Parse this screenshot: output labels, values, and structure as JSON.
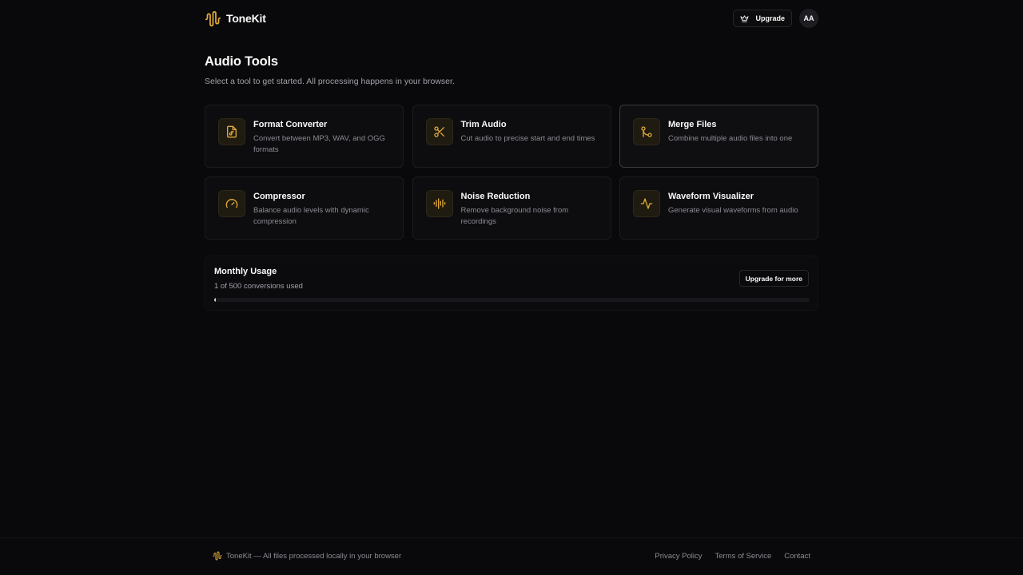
{
  "header": {
    "brand_name": "ToneKit",
    "upgrade_label": "Upgrade",
    "avatar_initials": "AA"
  },
  "page": {
    "title": "Audio Tools",
    "subtitle": "Select a tool to get started. All processing happens in your browser."
  },
  "tools": [
    {
      "name": "Format Converter",
      "description": "Convert between MP3, WAV, and OGG formats",
      "icon": "file-audio-icon"
    },
    {
      "name": "Trim Audio",
      "description": "Cut audio to precise start and end times",
      "icon": "scissors-icon"
    },
    {
      "name": "Merge Files",
      "description": "Combine multiple audio files into one",
      "icon": "git-merge-icon"
    },
    {
      "name": "Compressor",
      "description": "Balance audio levels with dynamic compression",
      "icon": "gauge-icon"
    },
    {
      "name": "Noise Reduction",
      "description": "Remove background noise from recordings",
      "icon": "audio-lines-icon"
    },
    {
      "name": "Waveform Visualizer",
      "description": "Generate visual waveforms from audio",
      "icon": "activity-icon"
    }
  ],
  "usage": {
    "title": "Monthly Usage",
    "summary": "1 of 500 conversions used",
    "used": 1,
    "limit": 500,
    "upgrade_label": "Upgrade for more"
  },
  "footer": {
    "text": "ToneKit — All files processed locally in your browser",
    "links": [
      "Privacy Policy",
      "Terms of Service",
      "Contact"
    ]
  },
  "colors": {
    "accent": "#e0a93a",
    "background": "#09090b"
  }
}
